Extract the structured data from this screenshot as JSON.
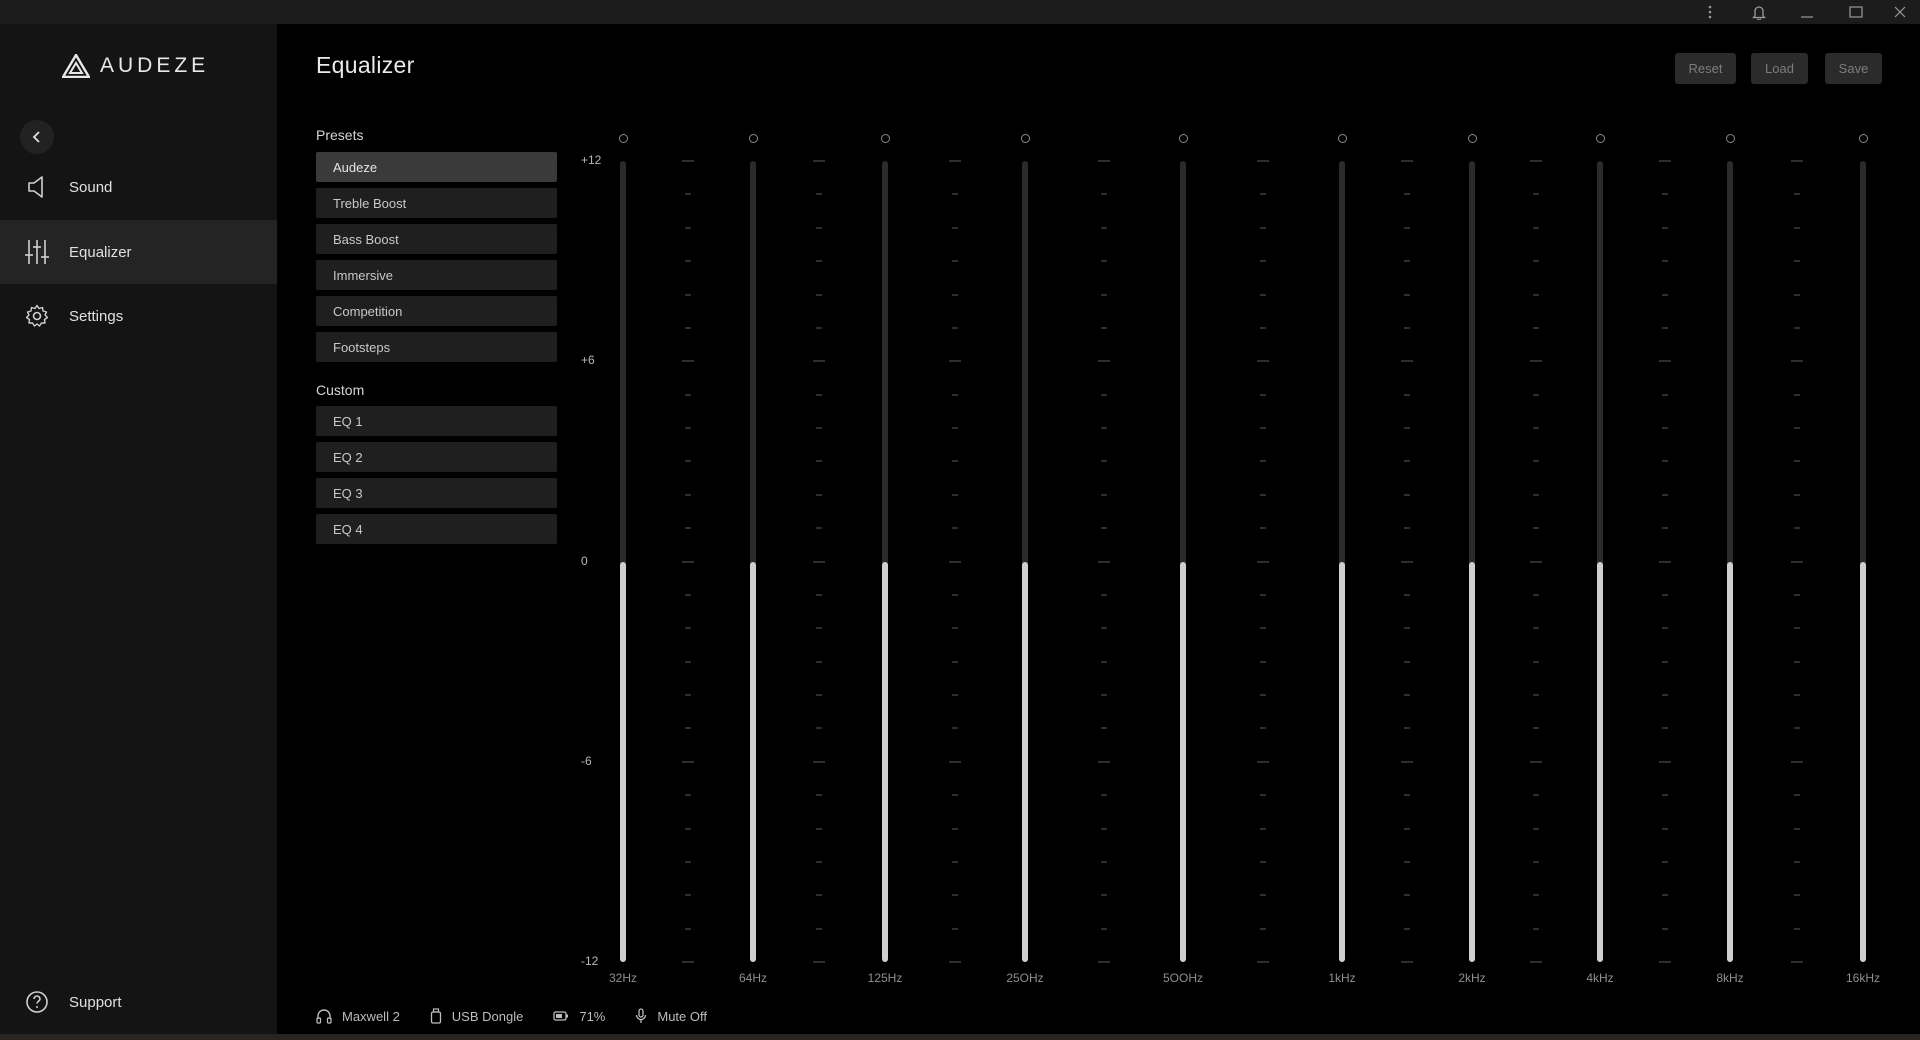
{
  "window": {
    "title_icons": [
      "more-vert-icon",
      "bell-icon",
      "minimize-icon",
      "maximize-icon",
      "close-icon"
    ]
  },
  "brand": {
    "name": "AUDEZE"
  },
  "sidebar": {
    "items": [
      {
        "label": "Sound",
        "icon": "speaker-icon",
        "active": false
      },
      {
        "label": "Equalizer",
        "icon": "sliders-icon",
        "active": true
      },
      {
        "label": "Settings",
        "icon": "gear-icon",
        "active": false
      }
    ],
    "support_label": "Support"
  },
  "page": {
    "title": "Equalizer"
  },
  "actions": {
    "reset": "Reset",
    "load": "Load",
    "save": "Save"
  },
  "presets": {
    "label": "Presets",
    "items": [
      "Audeze",
      "Treble Boost",
      "Bass Boost",
      "Immersive",
      "Competition",
      "Footsteps"
    ],
    "selected": "Audeze"
  },
  "custom": {
    "label": "Custom",
    "items": [
      "EQ 1",
      "EQ 2",
      "EQ 3",
      "EQ 4"
    ]
  },
  "equalizer": {
    "y_labels": [
      "+12",
      "+6",
      "0",
      "-6",
      "-12"
    ],
    "y_range": [
      -12,
      12
    ],
    "bands": [
      {
        "freq": "32Hz",
        "gain": 0
      },
      {
        "freq": "64Hz",
        "gain": 0
      },
      {
        "freq": "125Hz",
        "gain": 0
      },
      {
        "freq": "25OHz",
        "gain": 0
      },
      {
        "freq": "5OOHz",
        "gain": 0
      },
      {
        "freq": "1kHz",
        "gain": 0
      },
      {
        "freq": "2kHz",
        "gain": 0
      },
      {
        "freq": "4kHz",
        "gain": 0
      },
      {
        "freq": "8kHz",
        "gain": 0
      },
      {
        "freq": "16kHz",
        "gain": 0
      }
    ]
  },
  "status": {
    "device": "Maxwell 2",
    "connection": "USB Dongle",
    "battery": "71%",
    "mic": "Mute Off"
  },
  "colors": {
    "accent": "#cfcfcf",
    "background": "#000000",
    "sidebar": "#141414"
  }
}
